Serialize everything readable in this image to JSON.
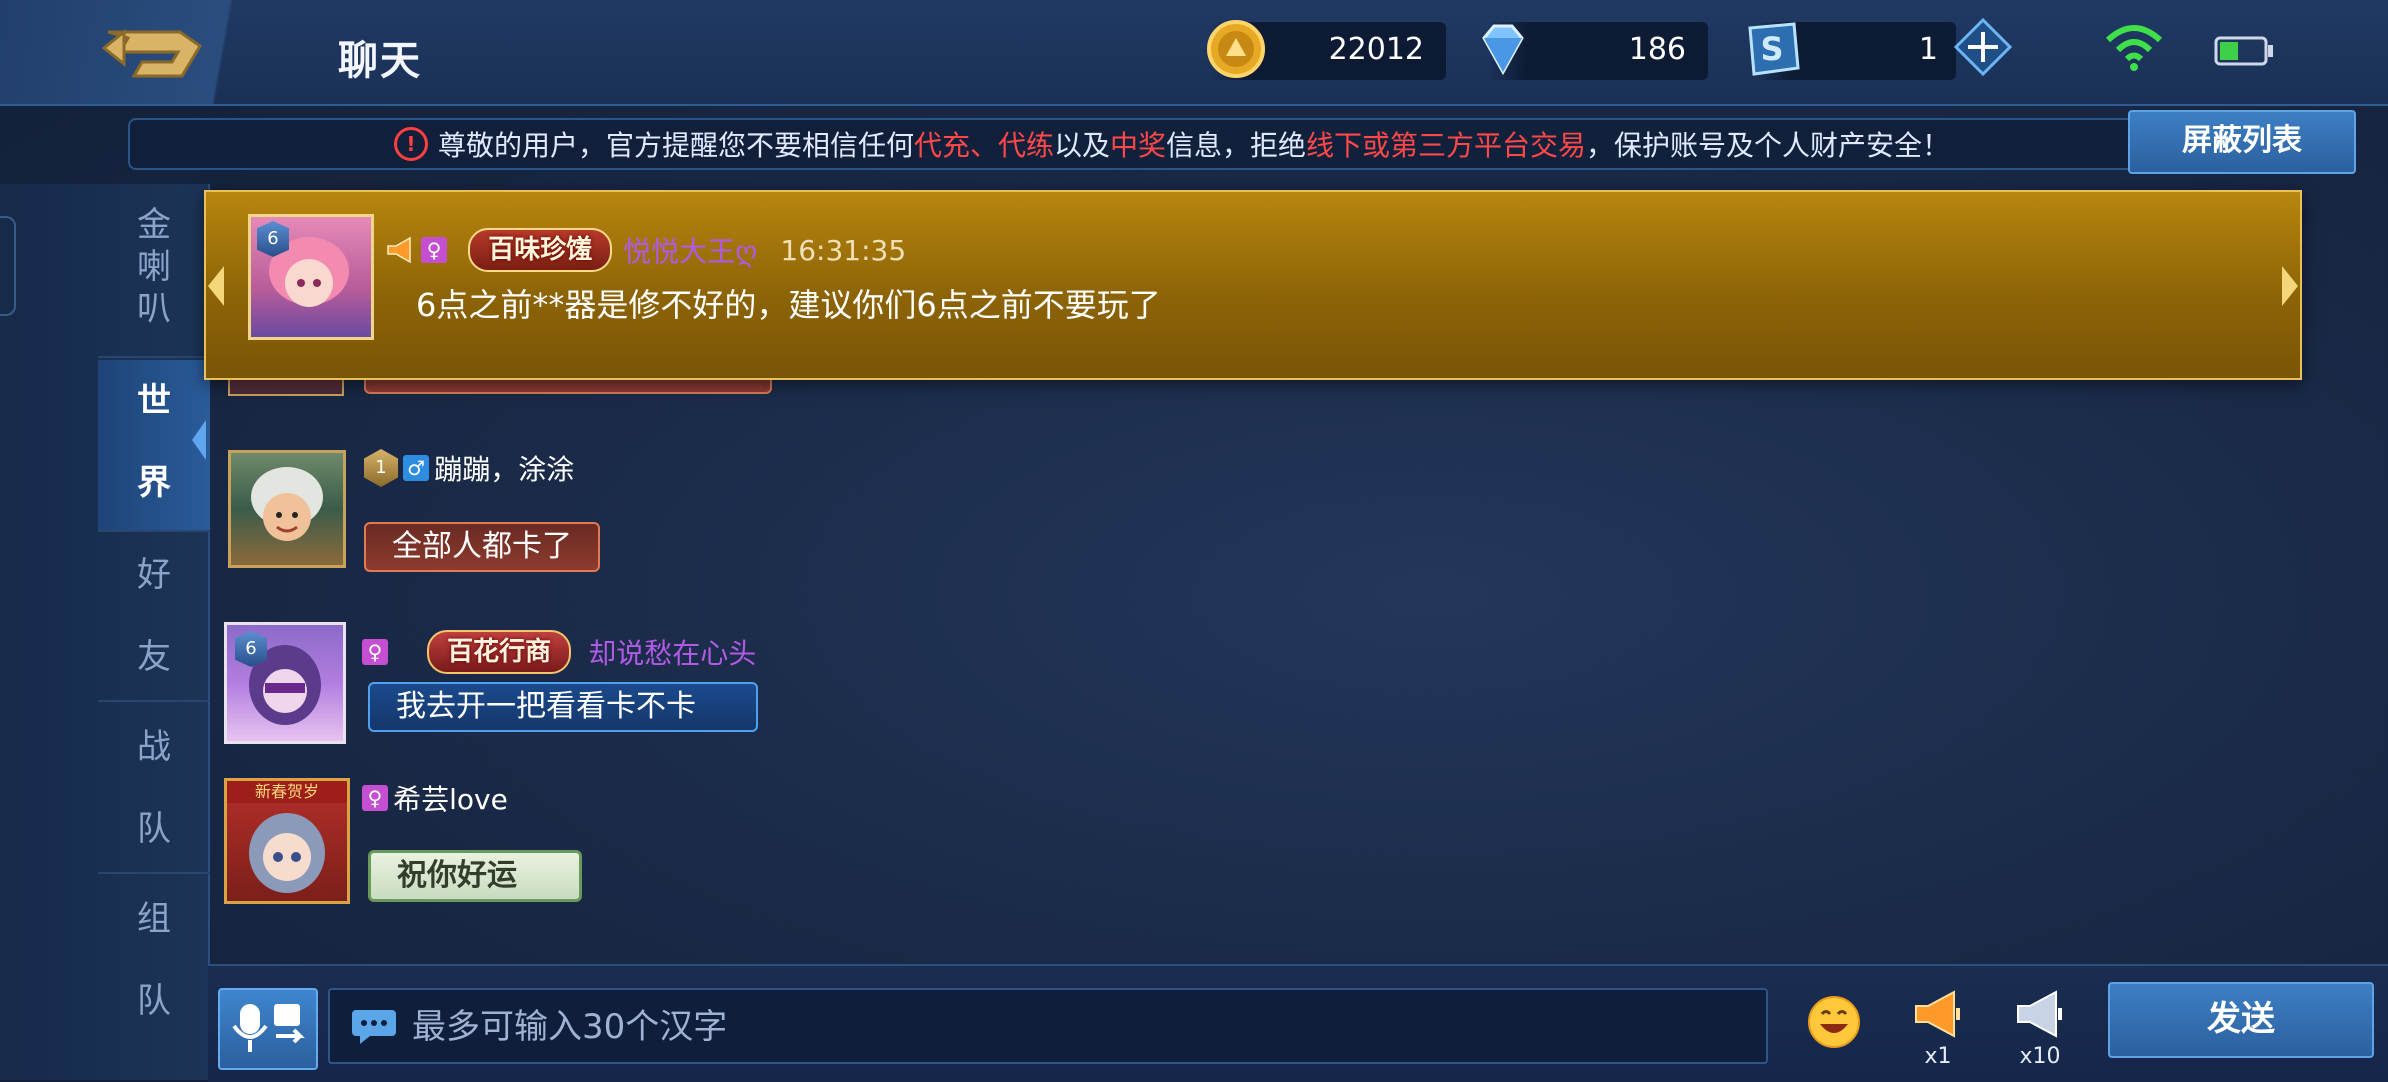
{
  "header": {
    "title": "聊天",
    "gold": "22012",
    "diamonds": "186",
    "tickets": "1"
  },
  "notice": {
    "part1": "尊敬的用户，官方提醒您不要相信任何",
    "red1": "代充、代练",
    "part2": "以及",
    "red2": "中奖",
    "part3": "信息，拒绝",
    "red3": "线下或第三方平台交易",
    "part4": "，保护账号及个人财产安全！",
    "block_list_label": "屏蔽列表"
  },
  "sidebar": {
    "tabs": [
      {
        "label": "金喇叭",
        "chars": [
          "金",
          "喇",
          "叭"
        ]
      },
      {
        "label": "世界",
        "chars": [
          "世",
          "界"
        ]
      },
      {
        "label": "好友",
        "chars": [
          "好",
          "友"
        ]
      },
      {
        "label": "战队",
        "chars": [
          "战",
          "队"
        ]
      },
      {
        "label": "组队",
        "chars": [
          "组",
          "队"
        ]
      }
    ]
  },
  "popup": {
    "title_badge": "百味珍馐",
    "username": "悦悦大王ღ",
    "time": "16:31:35",
    "message": "6点之前**器是修不好的，建议你们6点之前不要玩了"
  },
  "messages": [
    {
      "level": "1",
      "gender": "♂",
      "username": "蹦蹦，涂涂",
      "text": "全部人都卡了"
    },
    {
      "level": "6",
      "gender": "♀",
      "title_badge": "百花行商",
      "username": "却说愁在心头",
      "text": "我去开一把看看卡不卡"
    },
    {
      "gender": "♀",
      "username": "希芸love",
      "text": "祝你好运",
      "avatar_label": "新春贺岁"
    }
  ],
  "input": {
    "placeholder": "最多可输入30个汉字",
    "send_label": "发送",
    "speaker_small_count": "x1",
    "speaker_large_count": "x10"
  },
  "colors": {
    "accent_blue": "#2b609f",
    "notice_red": "#ff4848",
    "popup_gold": "#b8860f",
    "wifi_green": "#3fe04a",
    "battery_green": "#3fd04a"
  }
}
